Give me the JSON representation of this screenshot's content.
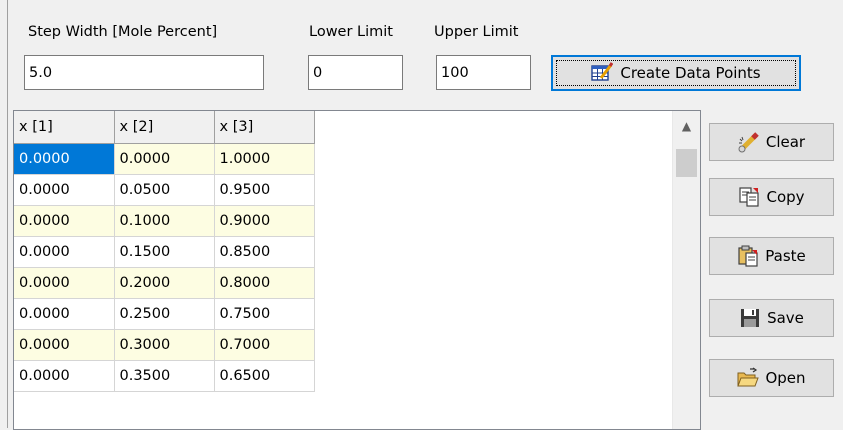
{
  "inputs": {
    "step_width": {
      "label": "Step Width [Mole Percent]",
      "value": "5.0"
    },
    "lower_limit": {
      "label": "Lower Limit",
      "value": "0"
    },
    "upper_limit": {
      "label": "Upper Limit",
      "value": "100"
    }
  },
  "create_button": {
    "label": "Create Data Points",
    "icon": "table-edit-icon"
  },
  "grid": {
    "columns": [
      "x [1]",
      "x [2]",
      "x [3]"
    ],
    "rows": [
      [
        "0.0000",
        "0.0000",
        "1.0000"
      ],
      [
        "0.0000",
        "0.0500",
        "0.9500"
      ],
      [
        "0.0000",
        "0.1000",
        "0.9000"
      ],
      [
        "0.0000",
        "0.1500",
        "0.8500"
      ],
      [
        "0.0000",
        "0.2000",
        "0.8000"
      ],
      [
        "0.0000",
        "0.2500",
        "0.7500"
      ],
      [
        "0.0000",
        "0.3000",
        "0.7000"
      ],
      [
        "0.0000",
        "0.3500",
        "0.6500"
      ]
    ],
    "selected_cell": "0.0000",
    "alt_row_color": "#fdfde2",
    "selection_color": "#0078d7"
  },
  "side_buttons": {
    "clear": {
      "label": "Clear",
      "icon": "eraser-icon"
    },
    "copy": {
      "label": "Copy",
      "icon": "copy-icon"
    },
    "paste": {
      "label": "Paste",
      "icon": "paste-icon"
    },
    "save": {
      "label": "Save",
      "icon": "floppy-disk-icon"
    },
    "open": {
      "label": "Open",
      "icon": "open-folder-icon"
    }
  }
}
